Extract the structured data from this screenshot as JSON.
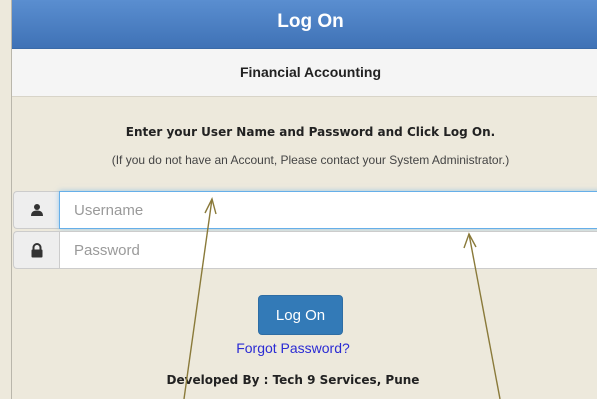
{
  "header": {
    "title": "Log On"
  },
  "subheader": {
    "title": "Financial Accounting"
  },
  "instructions": "Enter your User Name and Password and Click Log On.",
  "note": "(If you do not have an Account, Please contact your System Administrator.)",
  "username": {
    "placeholder": "Username",
    "icon": "user-icon"
  },
  "password": {
    "placeholder": "Password",
    "icon": "lock-icon"
  },
  "login_button": "Log On",
  "forgot_link": "Forgot Password?",
  "footer": "Developed By : Tech 9 Services, Pune",
  "colors": {
    "header": "#4a7fc4",
    "button": "#337ab7",
    "link": "#2b2bd4",
    "arrow": "#8a7a3a"
  }
}
